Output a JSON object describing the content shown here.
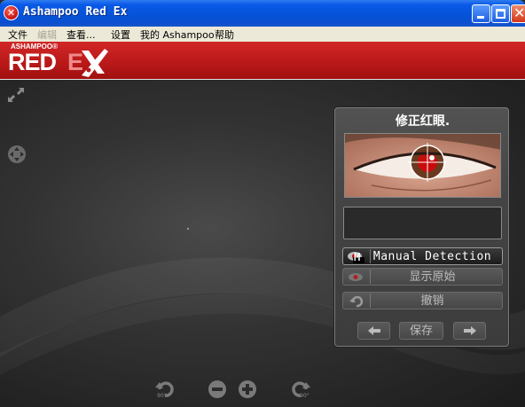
{
  "window": {
    "title": "Ashampoo Red Ex",
    "icon": "red-x-icon"
  },
  "menu": [
    {
      "label": "文件",
      "enabled": true
    },
    {
      "label": "编辑",
      "enabled": false
    },
    {
      "label": "查看...",
      "enabled": true
    },
    {
      "label": "设置",
      "enabled": true
    },
    {
      "label": "我的 Ashampoo",
      "enabled": true
    },
    {
      "label": "帮助",
      "enabled": true
    }
  ],
  "brand": {
    "small": "ASHAMPOO®",
    "big": "RED",
    "e": "E"
  },
  "panel": {
    "title": "修正红眼.",
    "buttons": {
      "manual_detection": "Manual Detection",
      "show_original": "显示原始",
      "undo": "撤销",
      "save": "保存"
    },
    "manual_badge": "M"
  },
  "bottom_toolbar": {
    "rotate_left_label": "90°",
    "rotate_right_label": "90°"
  },
  "colors": {
    "brand_red": "#c01c1c",
    "titlebar_blue": "#0553d8"
  }
}
